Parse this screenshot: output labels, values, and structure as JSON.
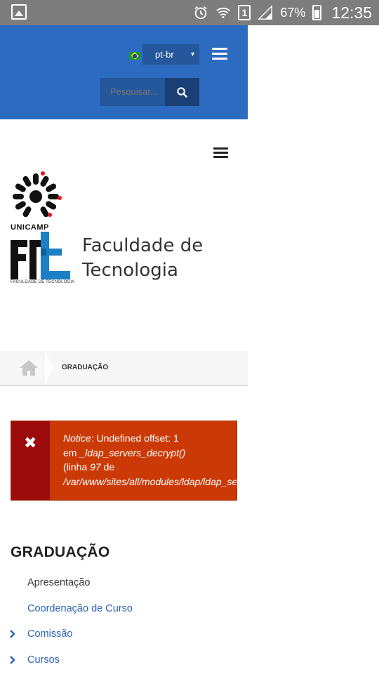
{
  "status_bar": {
    "battery_pct": "67%",
    "sim_label": "1",
    "time": "12:35",
    "icons": [
      "gallery-icon",
      "alarm-icon",
      "wifi-icon",
      "sim-icon",
      "signal-icon",
      "battery-icon"
    ]
  },
  "header": {
    "language": "pt-br",
    "language_caret": "▾",
    "search_placeholder": "Pesquisar...",
    "colors": {
      "header_bg": "#2d6bc0",
      "input_bg": "#24579b",
      "button_bg": "#1a3f75"
    }
  },
  "logos": {
    "unicamp_label": "UNICAMP",
    "ft_small_label": "FACULDADE DE TECNOLOGIA",
    "faculty_line1": "Faculdade de",
    "faculty_line2": "Tecnologia"
  },
  "breadcrumb": {
    "current": "GRADUAÇÃO"
  },
  "notice": {
    "icon": "✖",
    "label": "Notice",
    "message": ": Undefined offset: 1",
    "line2_prefix": "em ",
    "function": "_ldap_servers_decrypt()",
    "line3_prefix": "(linha ",
    "line_number": "97",
    "line3_suffix": " de",
    "path": "/var/www/sites/all/modules/ldap/ldap_se",
    "colors": {
      "bg": "#cb3a06",
      "side": "#9c0c0c"
    }
  },
  "section": {
    "title": "GRADUAÇÃO",
    "items": [
      {
        "label": "Apresentação",
        "chevron": false,
        "color": "#333333"
      },
      {
        "label": "Coordenação de Curso",
        "chevron": false,
        "color": "#2a63b5"
      },
      {
        "label": "Comissão",
        "chevron": true,
        "color": "#2a63b5"
      },
      {
        "label": "Cursos",
        "chevron": true,
        "color": "#2a63b5"
      }
    ]
  }
}
